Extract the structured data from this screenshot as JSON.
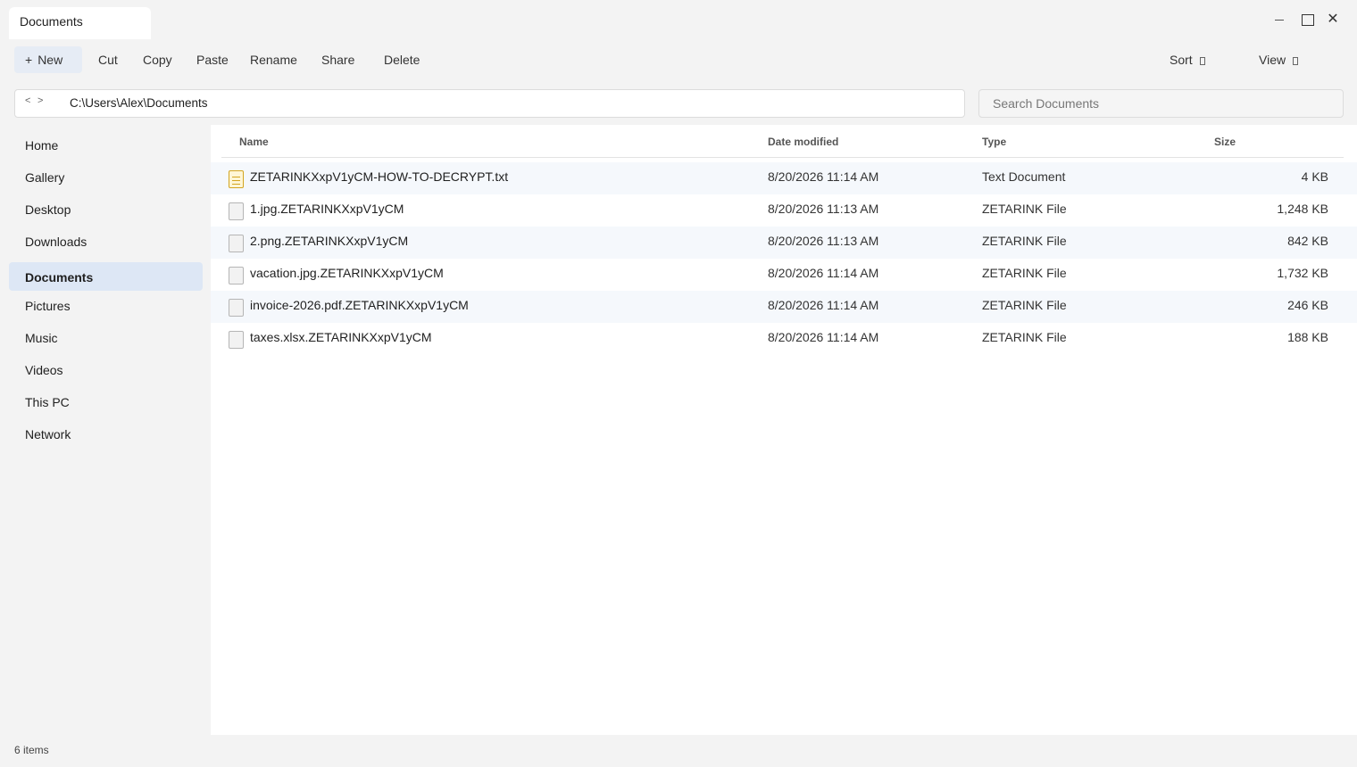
{
  "window": {
    "tab_title": "Documents",
    "minimize_icon": "minimize-icon",
    "maximize_icon": "maximize-icon",
    "close_icon": "close-icon"
  },
  "toolbar": {
    "new_label": "New",
    "new_icon": "plus-icon",
    "cut_label": "Cut",
    "copy_label": "Copy",
    "paste_label": "Paste",
    "rename_label": "Rename",
    "share_label": "Share",
    "delete_label": "Delete",
    "sort_label": "Sort",
    "view_label": "View"
  },
  "address": {
    "back": "<",
    "forward": ">",
    "path": "C:\\Users\\Alex\\Documents"
  },
  "search": {
    "placeholder": "Search Documents"
  },
  "sidebar": {
    "items": [
      {
        "label": "Home"
      },
      {
        "label": "Gallery"
      },
      {
        "label": "Desktop"
      },
      {
        "label": "Downloads"
      },
      {
        "label": "Documents",
        "active": true
      },
      {
        "label": "Pictures"
      },
      {
        "label": "Music"
      },
      {
        "label": "Videos"
      },
      {
        "label": "This PC"
      },
      {
        "label": "Network"
      }
    ]
  },
  "table": {
    "headers": {
      "name": "Name",
      "date": "Date modified",
      "type": "Type",
      "size": "Size"
    },
    "rows": [
      {
        "name": "ZETARINKXxpV1yCM-HOW-TO-DECRYPT.txt",
        "date": "8/20/2026 11:14 AM",
        "type": "Text Document",
        "size": "4 KB",
        "icon": "text-file-icon"
      },
      {
        "name": "1.jpg.ZETARINKXxpV1yCM",
        "date": "8/20/2026 11:13 AM",
        "type": "ZETARINK File",
        "size": "1,248 KB",
        "icon": "file-icon"
      },
      {
        "name": "2.png.ZETARINKXxpV1yCM",
        "date": "8/20/2026 11:13 AM",
        "type": "ZETARINK File",
        "size": "842 KB",
        "icon": "file-icon"
      },
      {
        "name": "vacation.jpg.ZETARINKXxpV1yCM",
        "date": "8/20/2026 11:14 AM",
        "type": "ZETARINK File",
        "size": "1,732 KB",
        "icon": "file-icon"
      },
      {
        "name": "invoice-2026.pdf.ZETARINKXxpV1yCM",
        "date": "8/20/2026 11:14 AM",
        "type": "ZETARINK File",
        "size": "246 KB",
        "icon": "file-icon"
      },
      {
        "name": "taxes.xlsx.ZETARINKXxpV1yCM",
        "date": "8/20/2026 11:14 AM",
        "type": "ZETARINK File",
        "size": "188 KB",
        "icon": "file-icon"
      }
    ]
  },
  "status": {
    "item_count": "6 items"
  },
  "colors": {
    "accent": "#dde7f5",
    "new_button_bg": "#e6ecf5",
    "row_alt": "#f5f8fc",
    "chrome_bg": "#f3f3f3"
  }
}
